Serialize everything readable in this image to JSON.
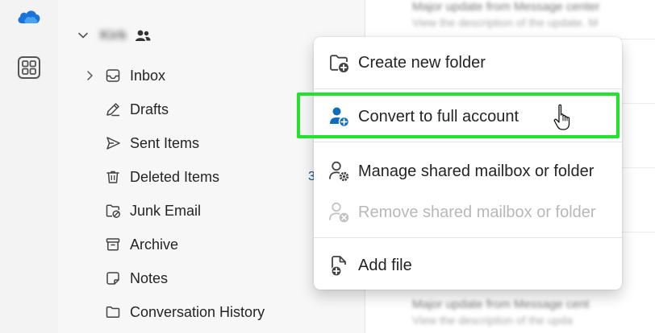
{
  "account": {
    "name": "Kirk"
  },
  "folders": [
    {
      "label": "Inbox",
      "count": ""
    },
    {
      "label": "Drafts",
      "count": ""
    },
    {
      "label": "Sent Items",
      "count": ""
    },
    {
      "label": "Deleted Items",
      "count": "3"
    },
    {
      "label": "Junk Email",
      "count": ""
    },
    {
      "label": "Archive",
      "count": ""
    },
    {
      "label": "Notes",
      "count": ""
    },
    {
      "label": "Conversation History",
      "count": ""
    }
  ],
  "messages": {
    "top_subject": "Major update from Message center",
    "top_preview": "View the description of the update. M",
    "bottom_subject": "Major update from Message cent",
    "bottom_preview": "View the description of the upda"
  },
  "context_menu": {
    "items": [
      {
        "label": "Create new folder",
        "icon": "folder-add-icon",
        "enabled": true
      },
      {
        "label": "Convert to full account",
        "icon": "person-add-icon",
        "enabled": true
      },
      {
        "label": "Manage shared mailbox or folder",
        "icon": "person-settings-icon",
        "enabled": true
      },
      {
        "label": "Remove shared mailbox or folder",
        "icon": "person-remove-icon",
        "enabled": false
      },
      {
        "label": "Add file",
        "icon": "document-add-icon",
        "enabled": true
      }
    ]
  },
  "colors": {
    "accent": "#0f6cbd",
    "highlight": "#22e32b",
    "rail_bg": "#f3f3f3",
    "pane_bg": "#f7f7f7"
  }
}
